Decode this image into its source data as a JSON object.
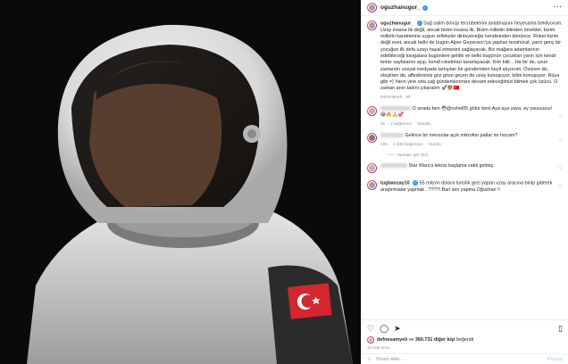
{
  "post": {
    "username": "oguzhanugur_",
    "caption_user": "oguzhanugur_",
    "caption": "Sağ salim dönüp tecrübelerini anlatmasını heyecanla bekliyorum. Uzay insana ilk değil, ancak bizim insana ilk. Bizim milletin dilinden örnekler, bizim milletin karakterine uygun refleksler dinleyeceğiz kendisinden dönünce. Roket bizim değil evet, ancak belki de bugün Alper Gezeravcı'ya yapılan tezahürat, yarın genç bir çocuğun ilk defa uzayı hayal etmesini sağlayacak. Biz mağara adamlarının edebileceği kavgalara bugünlere geldik ve belki bugünün çocukları yarın için kendi temiz sayfalarını açıp, kendi roketimizi tasarlayacak. Kim bilir... Ha bir de, uzun zamandır sosyal medyada tartışılan bir gündemden keyif alıyorum. Övünen de, eleştiren de, affedersiniz göz göze geçen de uzay konuşuyor, bilim konuşuyor. Rüya gibi =) Yarın yine orta çağ gündemlerimize devam edeceğimizi bilmek çok üzücü. O zaman anın tadını çıkaralım 🚀🧑‍🚀🇹🇷",
    "caption_meta": "9h",
    "edited": "Düzenlendi · 9h",
    "translate": "Çeviriyi gör"
  },
  "comments": [
    {
      "user": "",
      "text": "O sırada ben 😳@ozhel05 götür beni Aya aya yaya. ey yavuuuuu! 😂🔥🙏💞",
      "time": "2s",
      "likes": "2 beğenme",
      "reply": "Yanıtla",
      "mention": "@ozhel05"
    },
    {
      "user": "",
      "text": "Gelince bir mevzular açık mikrofon patlar mı hocam?",
      "time": "10s",
      "likes": "2.336 beğenme",
      "reply": "Yanıtla",
      "replies": "Yanıtları gör (52)"
    },
    {
      "user": "",
      "text": "Star Wars'a tekrar başlama vakti gelmiş.",
      "time": "",
      "likes": "",
      "reply": ""
    },
    {
      "user": "tugbaozay10",
      "text": "55 milyon dolara turistik gezi yapan uzay aracına binip giderek araştırmalar yapmak ..????! Bari sen yapma Oğuzhan !!",
      "time": "",
      "likes": "",
      "reply": ""
    }
  ],
  "likes_line": {
    "prefix": "defnesamyeli",
    "middle": "ve",
    "count": "360.731 diğer kişi",
    "suffix": "beğendi"
  },
  "timestamp": "10 saat önce",
  "comment_input": {
    "placeholder": "Yorum ekle...",
    "post_label": "Paylaş"
  },
  "icons": {
    "like": "heart-icon",
    "comment": "comment-icon",
    "share": "share-icon",
    "save": "bookmark-icon",
    "more": "more-options-icon",
    "emoji": "emoji-icon"
  },
  "colors": {
    "verified": "#3897f0",
    "link": "#00376b",
    "meta": "#8e8e8e"
  }
}
